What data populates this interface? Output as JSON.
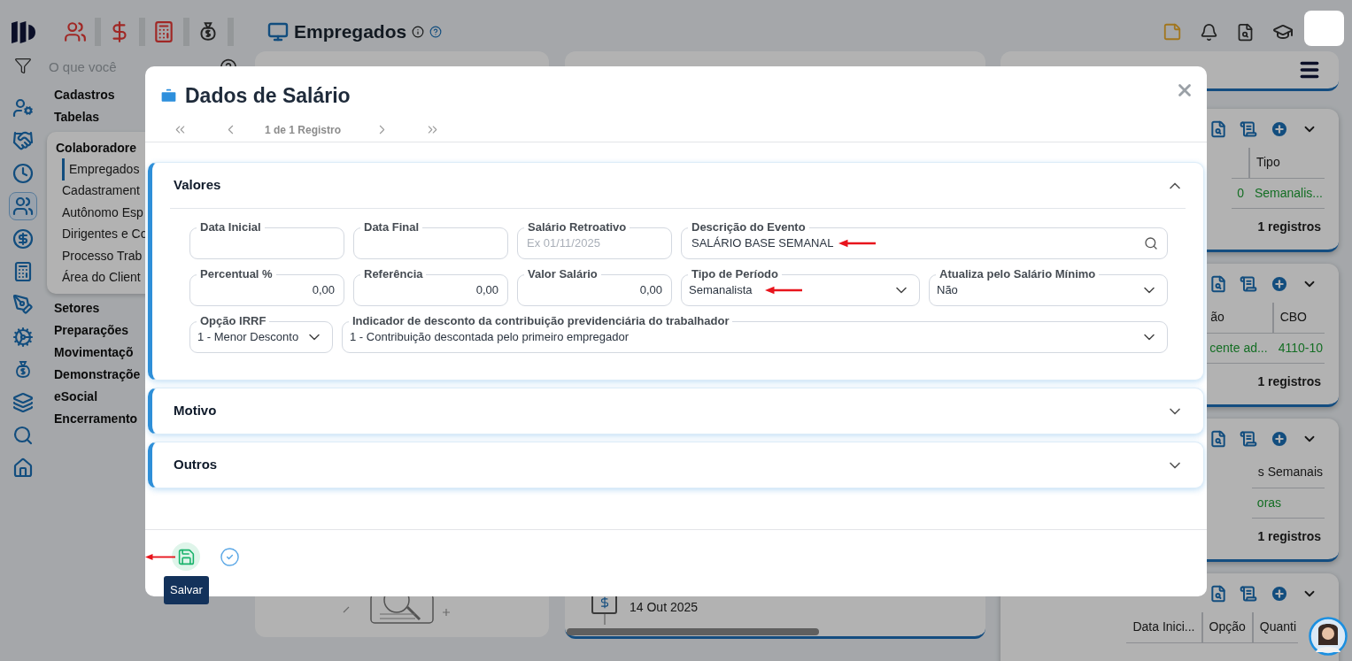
{
  "header": {
    "modules": [
      {
        "kind": "people"
      },
      {
        "kind": "dollar"
      },
      {
        "kind": "calculator"
      },
      {
        "kind": "money-bag"
      }
    ],
    "title": "Empregados"
  },
  "search": {
    "placeholder": "O que você"
  },
  "rail": [
    {
      "kind": "user-gear",
      "selected": false
    },
    {
      "kind": "handshake",
      "selected": false
    },
    {
      "kind": "clock",
      "selected": false
    },
    {
      "kind": "users",
      "selected": true
    },
    {
      "kind": "dollar",
      "selected": false
    },
    {
      "kind": "calculator",
      "selected": false
    },
    {
      "kind": "pen",
      "selected": false
    },
    {
      "kind": "cog",
      "selected": false
    },
    {
      "kind": "money-bag",
      "selected": false
    },
    {
      "kind": "layers",
      "selected": false
    },
    {
      "kind": "search",
      "selected": false
    },
    {
      "kind": "home",
      "selected": false
    }
  ],
  "menu": [
    {
      "label": "Cadastros"
    },
    {
      "label": "Tabelas"
    },
    {
      "label": "Colaboradore",
      "children": [
        {
          "label": "Empregados",
          "selected": true
        },
        {
          "label": "Cadastrament",
          "selected": false
        },
        {
          "label": "Autônomo Esp",
          "selected": false
        },
        {
          "label": "Dirigentes e Co",
          "selected": false
        },
        {
          "label": "Processo Trab",
          "selected": false
        },
        {
          "label": "Área do Client",
          "selected": false
        }
      ]
    },
    {
      "label": "Setores"
    },
    {
      "label": "Preparações"
    },
    {
      "label": "Movimentaçõ"
    },
    {
      "label": "Demonstraçõe"
    },
    {
      "label": "eSocial"
    },
    {
      "label": "Encerramento"
    }
  ],
  "timeline": {
    "date": "14 Out 2025"
  },
  "right_cards": [
    {
      "header": [
        "Tipo"
      ],
      "row": [
        "0",
        "Semanalis..."
      ],
      "footer": "1 registros"
    },
    {
      "header": [
        "ão",
        "CBO"
      ],
      "row": [
        "cente ad...",
        "4110-10"
      ],
      "footer": "1 registros"
    },
    {
      "header": [
        "s Semanais"
      ],
      "row": [
        "oras"
      ],
      "footer": "1 registros"
    },
    {
      "header": [
        "Data Inici...",
        "Opção",
        "Quanti"
      ]
    }
  ],
  "modal": {
    "title": "Dados de Salário",
    "pager": "1 de 1 Registro",
    "sections": [
      {
        "title": "Valores",
        "expanded": true,
        "rows": [
          [
            {
              "kind": "text",
              "label": "Data Inicial"
            },
            {
              "kind": "text",
              "label": "Data Final"
            },
            {
              "kind": "text",
              "label": "Salário Retroativo",
              "placeholder": "Ex 01/11/2025"
            },
            {
              "kind": "search",
              "label": "Descrição do Evento",
              "value": "SALÁRIO BASE SEMANAL",
              "annotated": true
            }
          ],
          [
            {
              "kind": "number",
              "label": "Percentual %",
              "value": "0,00"
            },
            {
              "kind": "number",
              "label": "Referência",
              "value": "0,00"
            },
            {
              "kind": "number",
              "label": "Valor Salário",
              "value": "0,00"
            },
            {
              "kind": "select",
              "label": "Tipo de Período",
              "value": "Semanalista",
              "annotated": true
            },
            {
              "kind": "select",
              "label": "Atualiza pelo Salário Mínimo",
              "value": "Não",
              "annotated": false
            }
          ],
          [
            {
              "kind": "select",
              "label": "Opção IRRF",
              "value": "1 - Menor Desconto",
              "annotated": false
            },
            {
              "kind": "select",
              "label": "Indicador de desconto da contribuição previdenciária do trabalhador",
              "value": "1 - Contribuição descontada pelo primeiro empregador",
              "annotated": false
            }
          ]
        ]
      },
      {
        "title": "Motivo",
        "expanded": false
      },
      {
        "title": "Outros",
        "expanded": false
      }
    ],
    "buttons": [
      {
        "kind": "save",
        "hovered": true,
        "annotated": true
      },
      {
        "kind": "confirm",
        "hovered": false,
        "annotated": false
      }
    ],
    "tooltip": "Salvar"
  }
}
